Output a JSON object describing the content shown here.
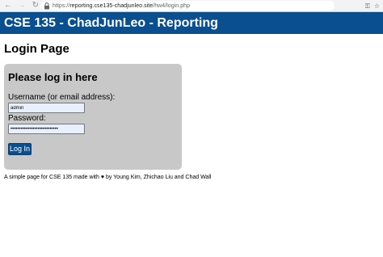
{
  "browser": {
    "back_icon": "←",
    "forward_icon": "→",
    "reload_icon": "↻",
    "url_prefix": "https://",
    "url_host": "reporting.cse135-chadjunleo.site",
    "url_path": "/hw4/login.php",
    "key_icon": "⚿",
    "star_icon": "☆"
  },
  "header": {
    "site_title": "CSE 135 - ChadJunLeo - Reporting"
  },
  "page": {
    "title": "Login Page"
  },
  "login_form": {
    "heading": "Please log in here",
    "username_label": "Username (or email address):",
    "username_value": "admin",
    "password_label": "Password:",
    "password_value": "••••••••••••••••••••••••••••",
    "submit_label": "Log In"
  },
  "footer": {
    "text": "A simple page for CSE 135 made with ♥ by Young Kim, Zhichao Liu and Chad Wall"
  },
  "colors": {
    "header_bg": "#0a4f8f",
    "card_bg": "#c8c8c8",
    "input_bg": "#e8f0fe"
  }
}
